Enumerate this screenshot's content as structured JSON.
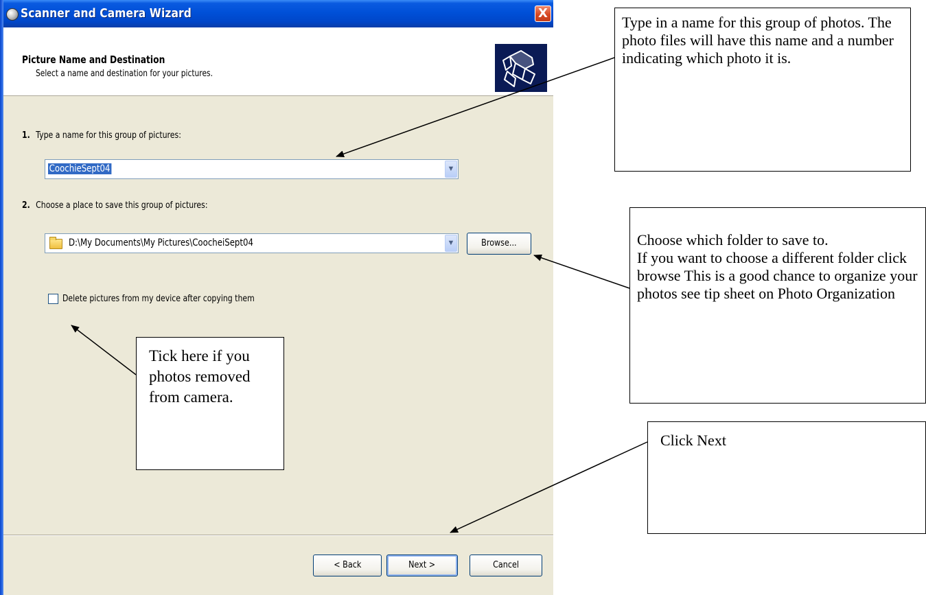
{
  "window": {
    "title": "Scanner and Camera Wizard",
    "close_glyph": "X"
  },
  "header": {
    "title": "Picture Name and Destination",
    "subtitle": "Select a name and destination for your pictures."
  },
  "step1": {
    "number": "1.",
    "label": "Type a name for this group of pictures:",
    "value": "CoochieSept04"
  },
  "step2": {
    "number": "2.",
    "label": "Choose a place to save this group of pictures:",
    "value": "D:\\My Documents\\My Pictures\\CoocheiSept04",
    "browse_label": "Browse..."
  },
  "delete_option": {
    "label": "Delete pictures from my device after copying them",
    "checked": false
  },
  "footer": {
    "back_label": "< Back",
    "next_label": "Next >",
    "cancel_label": "Cancel"
  },
  "callouts": {
    "name_group": "Type in  a name for this group of photos. The photo files will have this name and a number indicating which photo it is.",
    "choose_folder": "Choose which folder to save to.\nIf you want to choose a different folder click browse This is a good chance to organize your photos see tip sheet on Photo Organization",
    "tick_here": "Tick here if you photos removed from camera.",
    "click_next": "Click Next"
  },
  "icons": {
    "title_icon": "scanner-camera-icon",
    "header_icon": "wizard-camera-icon",
    "dropdown_arrow": "chevron-down-icon",
    "folder": "folder-icon",
    "checkbox": "checkbox-icon"
  },
  "colors": {
    "titlebar": "#0050d8",
    "dialog_bg": "#ece9d8",
    "selection": "#316ac5",
    "close_button": "#d74822"
  }
}
